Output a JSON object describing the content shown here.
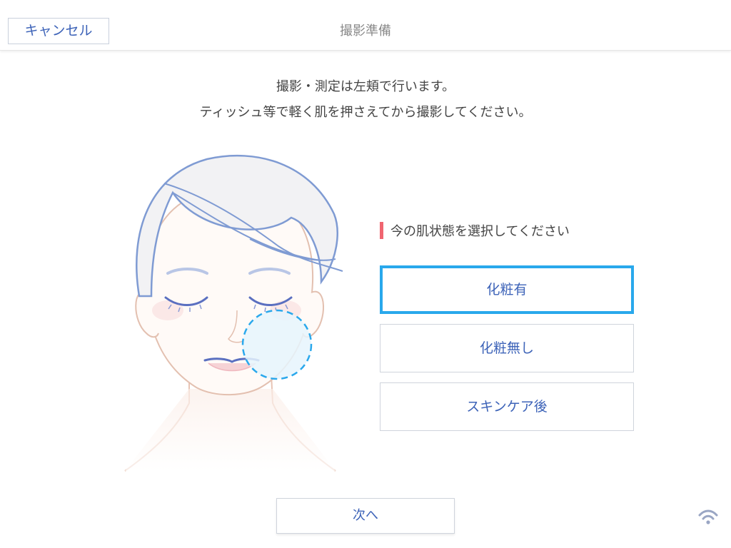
{
  "header": {
    "cancel_label": "キャンセル",
    "title": "撮影準備"
  },
  "instructions": {
    "line1": "撮影・測定は左頬で行います。",
    "line2": "ティッシュ等で軽く肌を押さえてから撮影してください。"
  },
  "illustration": {
    "highlight_region": "left-cheek",
    "icon": "face-illustration"
  },
  "skin_state": {
    "prompt": "今の肌状態を選択してください",
    "options": [
      {
        "label": "化粧有",
        "selected": true
      },
      {
        "label": "化粧無し",
        "selected": false
      },
      {
        "label": "スキンケア後",
        "selected": false
      }
    ]
  },
  "footer": {
    "next_label": "次へ",
    "status_icon": "wifi-icon"
  },
  "colors": {
    "accent": "#3d63b8",
    "selected_border": "#29a8ec",
    "label_bar": "#f06570"
  }
}
